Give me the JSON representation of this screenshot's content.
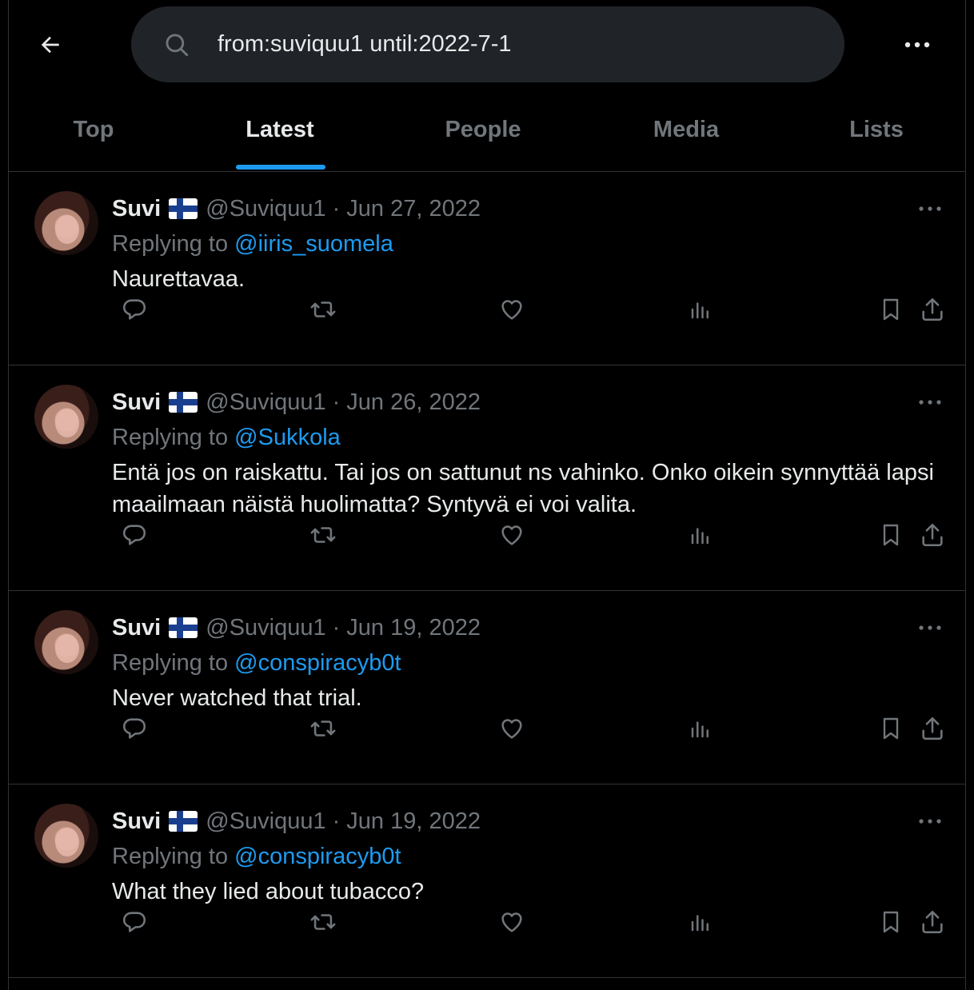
{
  "search": {
    "query": "from:suviquu1 until:2022-7-1"
  },
  "icons": {
    "back": "arrow-left-icon",
    "search": "search-icon",
    "more": "more-horizontal-icon"
  },
  "tabs": [
    {
      "label": "Top",
      "active": false
    },
    {
      "label": "Latest",
      "active": true
    },
    {
      "label": "People",
      "active": false
    },
    {
      "label": "Media",
      "active": false
    },
    {
      "label": "Lists",
      "active": false
    }
  ],
  "colors": {
    "accent": "#1d9bf0",
    "muted": "#71767b",
    "text": "#e7e9ea",
    "border": "#2f3336"
  },
  "tweets": [
    {
      "name": "Suvi",
      "handle": "@Suviquu1",
      "sep": "·",
      "date": "Jun 27, 2022",
      "replying_prefix": "Replying to",
      "replying_to": "@iiris_suomela",
      "text": "Naurettavaa."
    },
    {
      "name": "Suvi",
      "handle": "@Suviquu1",
      "sep": "·",
      "date": "Jun 26, 2022",
      "replying_prefix": "Replying to",
      "replying_to": "@Sukkola",
      "text": "Entä jos on raiskattu. Tai jos on sattunut ns vahinko. Onko oikein synnyttää lapsi maailmaan näistä huolimatta? Syntyvä ei voi valita."
    },
    {
      "name": "Suvi",
      "handle": "@Suviquu1",
      "sep": "·",
      "date": "Jun 19, 2022",
      "replying_prefix": "Replying to",
      "replying_to": "@conspiracyb0t",
      "text": "Never watched that trial."
    },
    {
      "name": "Suvi",
      "handle": "@Suviquu1",
      "sep": "·",
      "date": "Jun 19, 2022",
      "replying_prefix": "Replying to",
      "replying_to": "@conspiracyb0t",
      "text": "What they lied about tubacco?"
    }
  ]
}
